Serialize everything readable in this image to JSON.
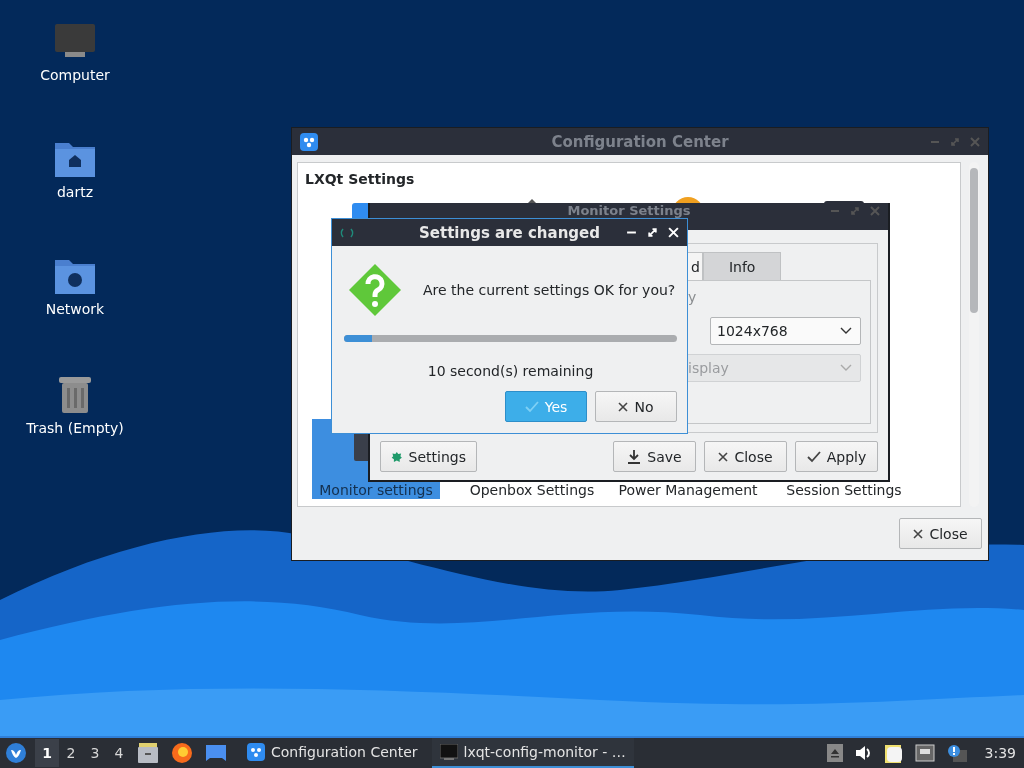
{
  "desktop_icons": [
    {
      "label": "Computer",
      "kind": "computer"
    },
    {
      "label": "dartz",
      "kind": "home"
    },
    {
      "label": "Network",
      "kind": "network"
    },
    {
      "label": "Trash (Empty)",
      "kind": "trash"
    }
  ],
  "config_center": {
    "title": "Configuration Center",
    "section_title": "LXQt Settings",
    "items": [
      {
        "label": "Monitor settings",
        "selected": true
      },
      {
        "label": "Openbox Settings",
        "selected": false
      },
      {
        "label": "Power Management",
        "selected": false
      },
      {
        "label": "Session Settings",
        "selected": false
      }
    ],
    "close_button": "Close"
  },
  "monitor_settings": {
    "title": "Monitor Settings",
    "tabs": [
      {
        "label": "d",
        "selected": true
      },
      {
        "label": "Info",
        "selected": false
      }
    ],
    "field_label": "y",
    "resolution": "1024x768",
    "display_combo": {
      "value": "isplay",
      "disabled": true
    },
    "buttons": [
      {
        "label": "Settings",
        "kind": "settings"
      },
      {
        "label": "Save",
        "kind": "save"
      },
      {
        "label": "Close",
        "kind": "close"
      },
      {
        "label": "Apply",
        "kind": "apply"
      }
    ]
  },
  "dialog": {
    "title": "Settings are changed",
    "message": "Are the current settings OK for you?",
    "level": 0.085,
    "remaining": "10 second(s) remaining",
    "buttons": [
      {
        "label": "Yes",
        "kind": "yes",
        "selected": true
      },
      {
        "label": "No",
        "kind": "no",
        "selected": false
      }
    ]
  },
  "taskbar": {
    "desktops": [
      {
        "label": "1",
        "selected": true
      },
      {
        "label": "2",
        "selected": false
      },
      {
        "label": "3",
        "selected": false
      },
      {
        "label": "4",
        "selected": false
      }
    ],
    "tasks": [
      {
        "title": "Configuration Center",
        "kind": "config",
        "active": false
      },
      {
        "title": "lxqt-config-monitor - …",
        "kind": "terminal",
        "active": true
      }
    ],
    "clock": "3:39"
  }
}
